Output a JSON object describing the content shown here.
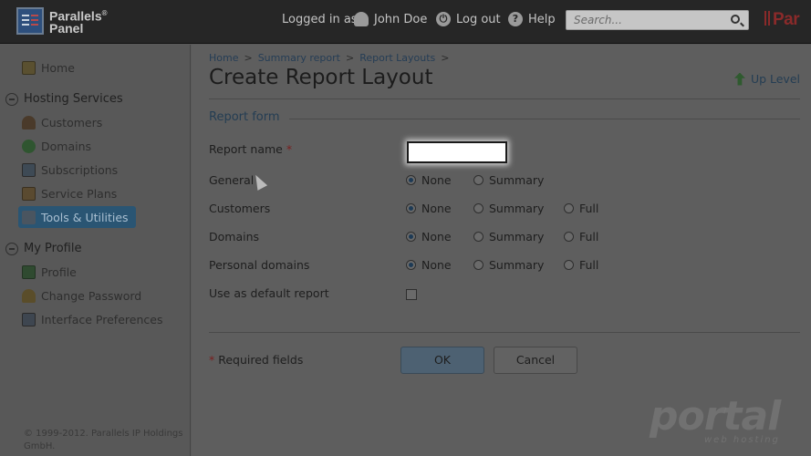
{
  "topbar": {
    "logo_line1": "Parallels",
    "logo_sup": "®",
    "logo_line2": "Panel",
    "logged_in_as": "Logged in as",
    "user_name": "John Doe",
    "logout": "Log out",
    "help": "Help",
    "search_placeholder": "Search...",
    "brand_partial": "Par"
  },
  "sidebar": {
    "home": "Home",
    "hosting_services": "Hosting Services",
    "customers": "Customers",
    "domains": "Domains",
    "subscriptions": "Subscriptions",
    "service_plans": "Service Plans",
    "tools_utilities": "Tools & Utilities",
    "my_profile": "My Profile",
    "profile": "Profile",
    "change_password": "Change Password",
    "interface_preferences": "Interface Preferences",
    "copyright": "© 1999-2012. Parallels IP Holdings GmbH."
  },
  "breadcrumb": {
    "items": [
      "Home",
      "Summary report",
      "Report Layouts"
    ],
    "separator": ">"
  },
  "page": {
    "title": "Create Report Layout",
    "up_level": "Up Level"
  },
  "form": {
    "section_title": "Report form",
    "report_name_label": "Report name",
    "required_mark": "*",
    "report_name_value": "",
    "general_label": "General",
    "customers_label": "Customers",
    "domains_label": "Domains",
    "personal_domains_label": "Personal domains",
    "default_report_label": "Use as default report",
    "default_report_checked": false,
    "option_none": "None",
    "option_summary": "Summary",
    "option_full": "Full",
    "selected": {
      "general": "None",
      "customers": "None",
      "domains": "None",
      "personal_domains": "None"
    },
    "required_fields_note": "Required fields",
    "ok_label": "OK",
    "cancel_label": "Cancel"
  },
  "watermark": {
    "text": "portal",
    "sub": "web hosting"
  },
  "colors": {
    "overlay_dim": "#5e5e5e",
    "topbar": "#262626",
    "active_nav": "#2a5573",
    "link": "#243d53",
    "required": "#7a1e1e"
  }
}
